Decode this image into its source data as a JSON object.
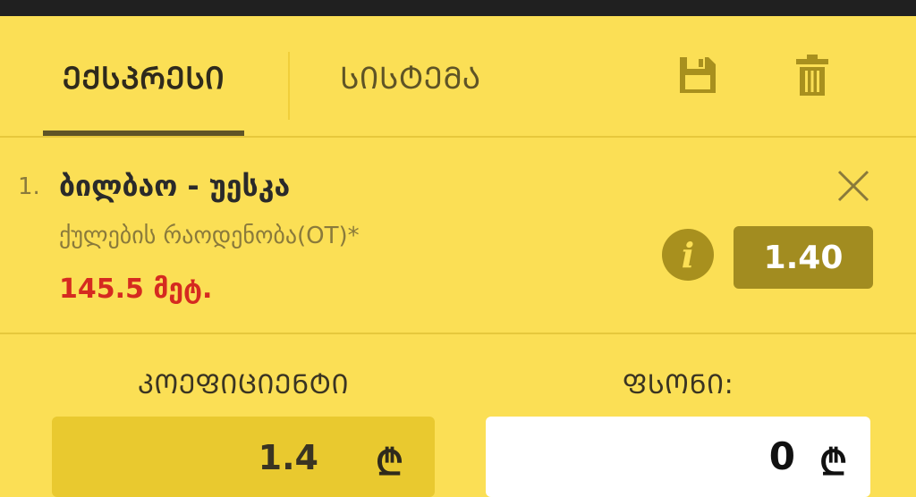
{
  "tabs": {
    "express": "ᲔᲥᲡᲞᲠᲔᲡᲘ",
    "system": "ᲡᲘᲡᲢᲔᲛᲐ"
  },
  "icons": {
    "save": "save-icon",
    "trash": "trash-icon",
    "close": "close-icon",
    "info": "info-icon",
    "currency": "lari-icon"
  },
  "bet": {
    "index": "1.",
    "event": "ბილბაო - უესკა",
    "market": "ქულების რაოდენობა(OT)*",
    "selection": "145.5 მეტ.",
    "odd": "1.40",
    "info_glyph": "i"
  },
  "fields": {
    "coefficient_label": "ᲙᲝᲔᲤᲘᲪᲘᲔᲜᲢᲘ",
    "coefficient_value": "1.4",
    "stake_label": "ᲤᲡᲝᲜᲘ:",
    "stake_value": "0",
    "currency_symbol": "₾"
  },
  "colors": {
    "background": "#fbdf55",
    "accent": "#a28c20",
    "selection_red": "#d52a20",
    "top_bar": "#202020"
  }
}
